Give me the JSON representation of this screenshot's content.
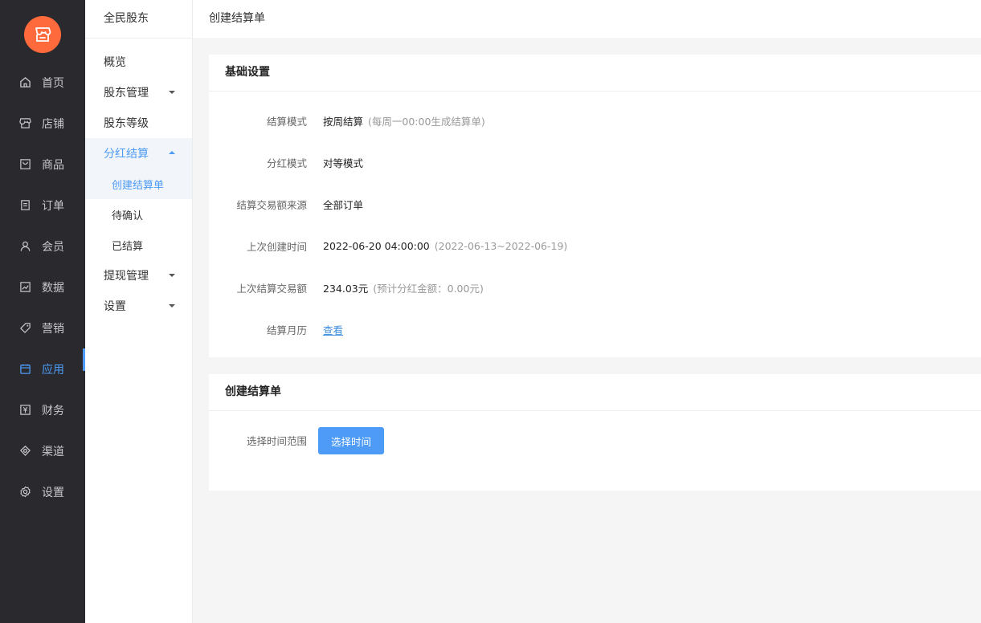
{
  "rail": {
    "items": [
      {
        "label": "首页",
        "icon": "home-icon"
      },
      {
        "label": "店铺",
        "icon": "store-icon"
      },
      {
        "label": "商品",
        "icon": "goods-icon"
      },
      {
        "label": "订单",
        "icon": "order-icon"
      },
      {
        "label": "会员",
        "icon": "member-icon"
      },
      {
        "label": "数据",
        "icon": "chart-icon"
      },
      {
        "label": "营销",
        "icon": "tag-icon"
      },
      {
        "label": "应用",
        "icon": "app-icon"
      },
      {
        "label": "财务",
        "icon": "finance-icon"
      },
      {
        "label": "渠道",
        "icon": "channel-icon"
      },
      {
        "label": "设置",
        "icon": "gear-icon"
      }
    ],
    "active": "应用",
    "accent": "#4d9bf6",
    "logo_color": "#ff6a3d"
  },
  "subnav": {
    "title": "全民股东",
    "items": [
      {
        "label": "概览"
      },
      {
        "label": "股东管理"
      },
      {
        "label": "股东等级"
      },
      {
        "label": "分红结算"
      },
      {
        "label": "创建结算单"
      },
      {
        "label": "待确认"
      },
      {
        "label": "已结算"
      },
      {
        "label": "提现管理"
      },
      {
        "label": "设置"
      }
    ]
  },
  "topbar": {
    "title": "创建结算单"
  },
  "basic": {
    "title": "基础设置",
    "rows": [
      {
        "label": "结算模式",
        "value": "按周结算",
        "note": "(每周一00:00生成结算单)"
      },
      {
        "label": "分红模式",
        "value": "对等模式"
      },
      {
        "label": "结算交易额来源",
        "value": "全部订单"
      },
      {
        "label": "上次创建时间",
        "value": "2022-06-20 04:00:00",
        "note": "(2022-06-13~2022-06-19)"
      },
      {
        "label": "上次结算交易额",
        "value": "234.03元",
        "note": "(预计分红金额：0.00元)"
      },
      {
        "label": "结算月历",
        "link": "查看"
      }
    ]
  },
  "create": {
    "title": "创建结算单",
    "range_label": "选择时间范围",
    "button": "选择时间"
  }
}
